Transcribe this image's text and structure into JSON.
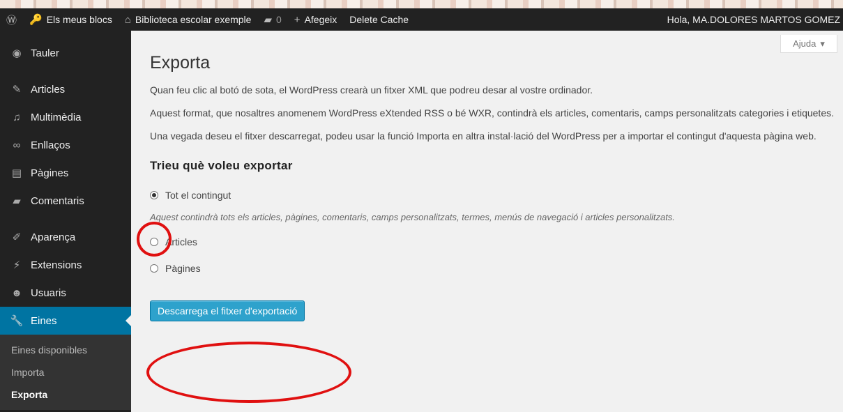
{
  "adminbar": {
    "wp_logo_icon": "wordpress-icon",
    "my_sites": "Els meus blocs",
    "site_name": "Biblioteca escolar exemple",
    "comments_count": "0",
    "new_label": "Afegeix",
    "cache_label": "Delete Cache",
    "greeting": "Hola, MA.DOLORES MARTOS GOMEZ"
  },
  "sidebar": {
    "items": [
      {
        "label": "Tauler",
        "icon": "dashboard-icon"
      },
      {
        "label": "Articles",
        "icon": "pin-icon"
      },
      {
        "label": "Multimèdia",
        "icon": "media-icon"
      },
      {
        "label": "Enllaços",
        "icon": "link-icon"
      },
      {
        "label": "Pàgines",
        "icon": "page-icon"
      },
      {
        "label": "Comentaris",
        "icon": "comment-icon"
      },
      {
        "label": "Aparença",
        "icon": "brush-icon"
      },
      {
        "label": "Extensions",
        "icon": "plugin-icon"
      },
      {
        "label": "Usuaris",
        "icon": "users-icon"
      },
      {
        "label": "Eines",
        "icon": "wrench-icon"
      }
    ],
    "submenu": [
      "Eines disponibles",
      "Importa",
      "Exporta"
    ]
  },
  "help_tab": "Ajuda",
  "main": {
    "title": "Exporta",
    "desc1": "Quan feu clic al botó de sota, el WordPress crearà un fitxer XML que podreu desar al vostre ordinador.",
    "desc2": "Aquest format, que nosaltres anomenem WordPress eXtended RSS o bé WXR, contindrà els articles, comentaris, camps personalitzats categories i etiquetes.",
    "desc3": "Una vegada deseu el fitxer descarregat, podeu usar la funció Importa en altra instal·lació del WordPress per a importar el contingut d'aquesta pàgina web.",
    "section_title": "Trieu què voleu exportar",
    "option_all": "Tot el contingut",
    "option_all_note": "Aquest contindrà tots els articles, pàgines, comentaris, camps personalitzats, termes, menús de navegació i articles personalitzats.",
    "option_posts": "Articles",
    "option_pages": "Pàgines",
    "download_button": "Descarrega el fitxer d'exportació"
  },
  "colors": {
    "accent": "#0074a2",
    "button": "#2ea2cc",
    "annotation": "#e01010"
  }
}
